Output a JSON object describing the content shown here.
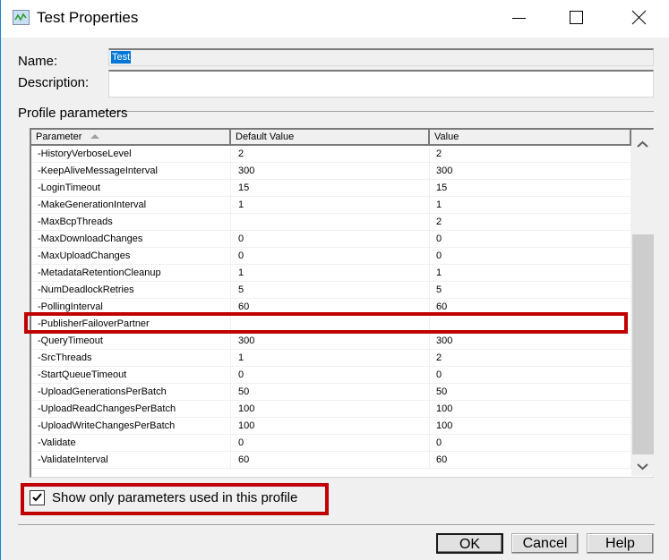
{
  "window": {
    "title": "Test Properties",
    "minimize_label": "Minimize",
    "maximize_label": "Maximize",
    "close_label": "Close"
  },
  "form": {
    "name_label": "Name:",
    "name_value": "Test",
    "description_label": "Description:",
    "description_value": ""
  },
  "profile_parameters": {
    "group_label": "Profile parameters",
    "columns": [
      "Parameter",
      "Default Value",
      "Value"
    ],
    "sort_column": "Parameter",
    "sort_direction": "ascending",
    "rows": [
      {
        "parameter": "-HistoryVerboseLevel",
        "default": "2",
        "value": "2"
      },
      {
        "parameter": "-KeepAliveMessageInterval",
        "default": "300",
        "value": "300"
      },
      {
        "parameter": "-LoginTimeout",
        "default": "15",
        "value": "15"
      },
      {
        "parameter": "-MakeGenerationInterval",
        "default": "1",
        "value": "1"
      },
      {
        "parameter": "-MaxBcpThreads",
        "default": "",
        "value": "2"
      },
      {
        "parameter": "-MaxDownloadChanges",
        "default": "0",
        "value": "0"
      },
      {
        "parameter": "-MaxUploadChanges",
        "default": "0",
        "value": "0"
      },
      {
        "parameter": "-MetadataRetentionCleanup",
        "default": "1",
        "value": "1"
      },
      {
        "parameter": "-NumDeadlockRetries",
        "default": "5",
        "value": "5"
      },
      {
        "parameter": "-PollingInterval",
        "default": "60",
        "value": "60"
      },
      {
        "parameter": "-PublisherFailoverPartner",
        "default": "",
        "value": "",
        "highlighted": true
      },
      {
        "parameter": "-QueryTimeout",
        "default": "300",
        "value": "300"
      },
      {
        "parameter": "-SrcThreads",
        "default": "1",
        "value": "2"
      },
      {
        "parameter": "-StartQueueTimeout",
        "default": "0",
        "value": "0"
      },
      {
        "parameter": "-UploadGenerationsPerBatch",
        "default": "50",
        "value": "50"
      },
      {
        "parameter": "-UploadReadChangesPerBatch",
        "default": "100",
        "value": "100"
      },
      {
        "parameter": "-UploadWriteChangesPerBatch",
        "default": "100",
        "value": "100"
      },
      {
        "parameter": "-Validate",
        "default": "0",
        "value": "0"
      },
      {
        "parameter": "-ValidateInterval",
        "default": "60",
        "value": "60"
      }
    ]
  },
  "options": {
    "show_only_used_label": "Show only parameters used in this profile",
    "show_only_used_checked": true
  },
  "buttons": {
    "ok": "OK",
    "cancel": "Cancel",
    "help": "Help"
  },
  "colors": {
    "highlight": "#c00000",
    "selection": "#0078d7",
    "dialog_bg": "#f0f0f0"
  }
}
